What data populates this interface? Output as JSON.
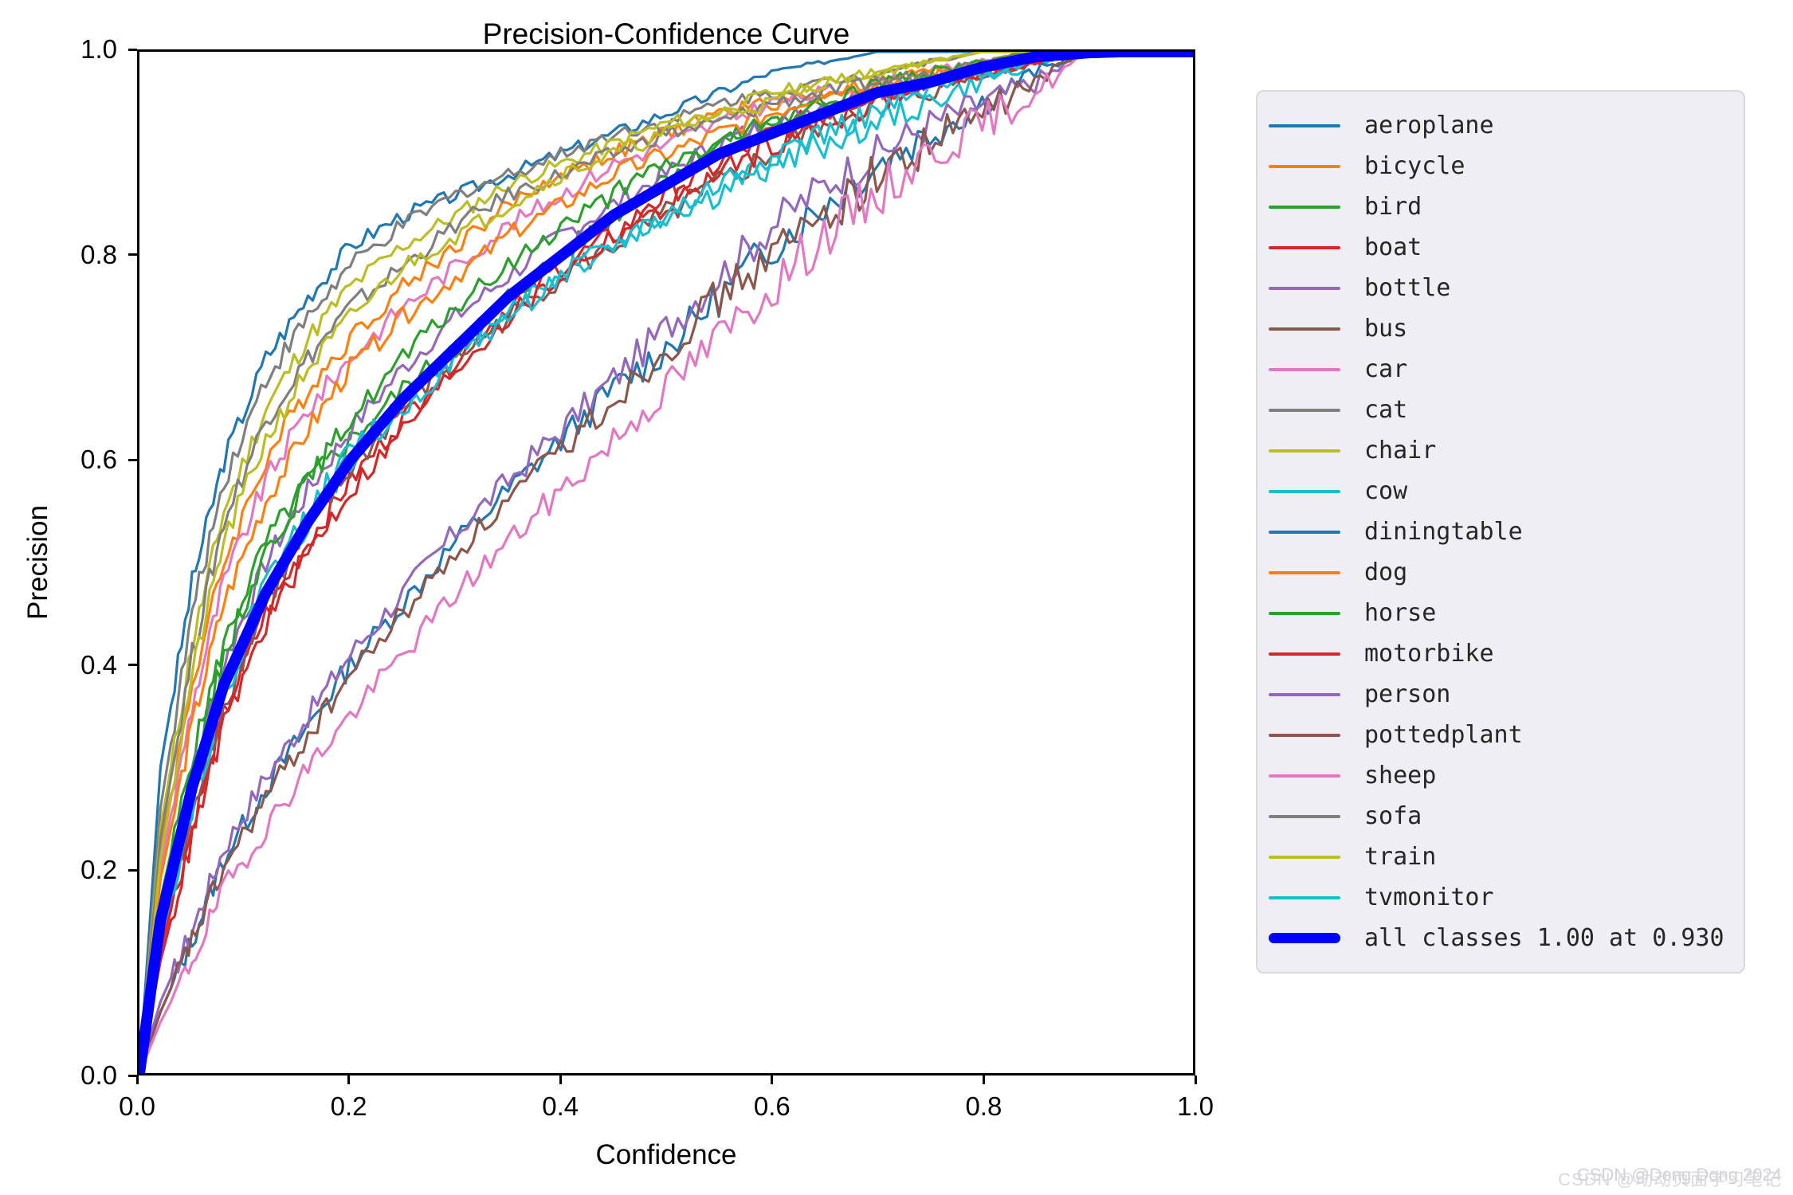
{
  "chart_data": {
    "type": "line",
    "title": "Precision-Confidence Curve",
    "xlabel": "Confidence",
    "ylabel": "Precision",
    "xlim": [
      0.0,
      1.0
    ],
    "ylim": [
      0.0,
      1.0
    ],
    "xticks": [
      "0.0",
      "0.2",
      "0.4",
      "0.6",
      "0.8",
      "1.0"
    ],
    "yticks": [
      "0.0",
      "0.2",
      "0.4",
      "0.6",
      "0.8",
      "1.0"
    ],
    "xtick_values": [
      0.0,
      0.2,
      0.4,
      0.6,
      0.8,
      1.0
    ],
    "ytick_values": [
      0.0,
      0.2,
      0.4,
      0.6,
      0.8,
      1.0
    ],
    "grid": false,
    "legend_position": "right outside",
    "summary_label": "all classes 1.00 at 0.930",
    "summary_precision": 1.0,
    "summary_confidence": 0.93,
    "x": [
      0.0,
      0.02,
      0.05,
      0.08,
      0.12,
      0.16,
      0.2,
      0.25,
      0.3,
      0.35,
      0.4,
      0.45,
      0.5,
      0.55,
      0.6,
      0.65,
      0.7,
      0.75,
      0.8,
      0.85,
      0.9,
      0.93,
      1.0
    ],
    "series": [
      {
        "name": "aeroplane",
        "color": "#1f77b4",
        "values": [
          0.0,
          0.3,
          0.48,
          0.6,
          0.7,
          0.76,
          0.81,
          0.84,
          0.86,
          0.88,
          0.9,
          0.92,
          0.94,
          0.96,
          0.98,
          0.99,
          1.0,
          1.0,
          1.0,
          1.0,
          1.0,
          1.0,
          1.0
        ]
      },
      {
        "name": "bicycle",
        "color": "#ff7f0e",
        "values": [
          0.0,
          0.22,
          0.38,
          0.5,
          0.6,
          0.67,
          0.72,
          0.77,
          0.81,
          0.85,
          0.88,
          0.9,
          0.92,
          0.94,
          0.95,
          0.96,
          0.97,
          0.98,
          0.99,
          1.0,
          1.0,
          1.0,
          1.0
        ]
      },
      {
        "name": "bird",
        "color": "#2ca02c",
        "values": [
          0.0,
          0.17,
          0.31,
          0.42,
          0.52,
          0.58,
          0.62,
          0.67,
          0.71,
          0.76,
          0.8,
          0.84,
          0.88,
          0.91,
          0.93,
          0.95,
          0.96,
          0.97,
          0.98,
          0.99,
          1.0,
          1.0,
          1.0
        ]
      },
      {
        "name": "boat",
        "color": "#d62728",
        "values": [
          0.0,
          0.12,
          0.24,
          0.35,
          0.45,
          0.52,
          0.58,
          0.64,
          0.7,
          0.75,
          0.79,
          0.82,
          0.86,
          0.89,
          0.92,
          0.94,
          0.96,
          0.97,
          0.98,
          0.99,
          1.0,
          1.0,
          1.0
        ]
      },
      {
        "name": "bottle",
        "color": "#9467bd",
        "values": [
          0.0,
          0.16,
          0.29,
          0.4,
          0.5,
          0.57,
          0.63,
          0.69,
          0.74,
          0.78,
          0.82,
          0.85,
          0.88,
          0.91,
          0.93,
          0.95,
          0.96,
          0.97,
          0.98,
          0.99,
          1.0,
          1.0,
          1.0
        ]
      },
      {
        "name": "bus",
        "color": "#8c564b",
        "values": [
          0.0,
          0.13,
          0.25,
          0.36,
          0.46,
          0.53,
          0.59,
          0.65,
          0.7,
          0.74,
          0.78,
          0.81,
          0.84,
          0.87,
          0.9,
          0.93,
          0.95,
          0.96,
          0.98,
          0.99,
          1.0,
          1.0,
          1.0
        ]
      },
      {
        "name": "car",
        "color": "#e377c2",
        "values": [
          0.0,
          0.2,
          0.36,
          0.48,
          0.58,
          0.65,
          0.7,
          0.75,
          0.79,
          0.83,
          0.86,
          0.89,
          0.91,
          0.93,
          0.95,
          0.96,
          0.97,
          0.98,
          0.99,
          1.0,
          1.0,
          1.0,
          1.0
        ]
      },
      {
        "name": "cat",
        "color": "#7f7f7f",
        "values": [
          0.0,
          0.26,
          0.45,
          0.58,
          0.68,
          0.74,
          0.79,
          0.83,
          0.86,
          0.88,
          0.9,
          0.92,
          0.93,
          0.95,
          0.96,
          0.97,
          0.98,
          0.99,
          1.0,
          1.0,
          1.0,
          1.0,
          1.0
        ]
      },
      {
        "name": "chair",
        "color": "#bcbd22",
        "values": [
          0.0,
          0.24,
          0.42,
          0.55,
          0.65,
          0.72,
          0.77,
          0.81,
          0.84,
          0.87,
          0.89,
          0.91,
          0.93,
          0.94,
          0.96,
          0.97,
          0.98,
          0.99,
          1.0,
          1.0,
          1.0,
          1.0,
          1.0
        ]
      },
      {
        "name": "cow",
        "color": "#17becf",
        "values": [
          0.0,
          0.14,
          0.27,
          0.38,
          0.48,
          0.55,
          0.61,
          0.66,
          0.71,
          0.75,
          0.78,
          0.81,
          0.84,
          0.86,
          0.89,
          0.91,
          0.93,
          0.95,
          0.97,
          0.99,
          1.0,
          1.0,
          1.0
        ]
      },
      {
        "name": "diningtable",
        "color": "#1f77b4",
        "values": [
          0.0,
          0.06,
          0.13,
          0.21,
          0.28,
          0.34,
          0.4,
          0.46,
          0.52,
          0.57,
          0.62,
          0.67,
          0.71,
          0.76,
          0.81,
          0.85,
          0.89,
          0.92,
          0.95,
          0.98,
          1.0,
          1.0,
          1.0
        ]
      },
      {
        "name": "dog",
        "color": "#ff7f0e",
        "values": [
          0.0,
          0.19,
          0.34,
          0.46,
          0.56,
          0.63,
          0.69,
          0.74,
          0.78,
          0.82,
          0.85,
          0.88,
          0.9,
          0.92,
          0.94,
          0.96,
          0.97,
          0.98,
          0.99,
          1.0,
          1.0,
          1.0,
          1.0
        ]
      },
      {
        "name": "horse",
        "color": "#2ca02c",
        "values": [
          0.0,
          0.15,
          0.29,
          0.41,
          0.51,
          0.58,
          0.64,
          0.7,
          0.75,
          0.79,
          0.83,
          0.86,
          0.89,
          0.91,
          0.93,
          0.95,
          0.97,
          0.98,
          0.99,
          1.0,
          1.0,
          1.0,
          1.0
        ]
      },
      {
        "name": "motorbike",
        "color": "#d62728",
        "values": [
          0.0,
          0.11,
          0.23,
          0.34,
          0.44,
          0.51,
          0.57,
          0.63,
          0.69,
          0.74,
          0.78,
          0.82,
          0.85,
          0.88,
          0.91,
          0.93,
          0.95,
          0.97,
          0.98,
          0.99,
          1.0,
          1.0,
          1.0
        ]
      },
      {
        "name": "person",
        "color": "#9467bd",
        "values": [
          0.0,
          0.07,
          0.14,
          0.22,
          0.29,
          0.35,
          0.41,
          0.47,
          0.53,
          0.58,
          0.63,
          0.68,
          0.73,
          0.78,
          0.83,
          0.87,
          0.9,
          0.93,
          0.95,
          0.97,
          1.0,
          1.0,
          1.0
        ]
      },
      {
        "name": "pottedplant",
        "color": "#8c564b",
        "values": [
          0.0,
          0.06,
          0.13,
          0.2,
          0.27,
          0.33,
          0.39,
          0.45,
          0.51,
          0.56,
          0.61,
          0.66,
          0.71,
          0.76,
          0.8,
          0.84,
          0.88,
          0.91,
          0.94,
          0.97,
          1.0,
          1.0,
          1.0
        ]
      },
      {
        "name": "sheep",
        "color": "#e377c2",
        "values": [
          0.0,
          0.05,
          0.11,
          0.18,
          0.24,
          0.3,
          0.35,
          0.41,
          0.47,
          0.52,
          0.57,
          0.62,
          0.67,
          0.72,
          0.77,
          0.82,
          0.86,
          0.9,
          0.93,
          0.96,
          1.0,
          1.0,
          1.0
        ]
      },
      {
        "name": "sofa",
        "color": "#7f7f7f",
        "values": [
          0.0,
          0.23,
          0.41,
          0.54,
          0.64,
          0.7,
          0.75,
          0.79,
          0.83,
          0.86,
          0.88,
          0.9,
          0.92,
          0.93,
          0.95,
          0.96,
          0.97,
          0.98,
          0.99,
          1.0,
          1.0,
          1.0,
          1.0
        ]
      },
      {
        "name": "train",
        "color": "#bcbd22",
        "values": [
          0.0,
          0.21,
          0.39,
          0.52,
          0.62,
          0.69,
          0.74,
          0.79,
          0.82,
          0.85,
          0.88,
          0.9,
          0.92,
          0.94,
          0.95,
          0.97,
          0.98,
          0.99,
          1.0,
          1.0,
          1.0,
          1.0,
          1.0
        ]
      },
      {
        "name": "tvmonitor",
        "color": "#17becf",
        "values": [
          0.0,
          0.13,
          0.26,
          0.37,
          0.47,
          0.54,
          0.6,
          0.65,
          0.7,
          0.74,
          0.78,
          0.81,
          0.84,
          0.87,
          0.9,
          0.92,
          0.94,
          0.96,
          0.98,
          0.99,
          1.0,
          1.0,
          1.0
        ]
      },
      {
        "name": "all classes 1.00 at 0.930",
        "color": "#0000ff",
        "emphasis": true,
        "values": [
          0.0,
          0.15,
          0.28,
          0.38,
          0.47,
          0.54,
          0.6,
          0.66,
          0.71,
          0.76,
          0.8,
          0.84,
          0.87,
          0.9,
          0.92,
          0.94,
          0.96,
          0.97,
          0.985,
          0.995,
          0.999,
          1.0,
          1.0
        ]
      }
    ]
  },
  "legend": {
    "entries": [
      {
        "label": "aeroplane",
        "color": "#1f77b4",
        "thick": false
      },
      {
        "label": "bicycle",
        "color": "#ff7f0e",
        "thick": false
      },
      {
        "label": "bird",
        "color": "#2ca02c",
        "thick": false
      },
      {
        "label": "boat",
        "color": "#d62728",
        "thick": false
      },
      {
        "label": "bottle",
        "color": "#9467bd",
        "thick": false
      },
      {
        "label": "bus",
        "color": "#8c564b",
        "thick": false
      },
      {
        "label": "car",
        "color": "#e377c2",
        "thick": false
      },
      {
        "label": "cat",
        "color": "#7f7f7f",
        "thick": false
      },
      {
        "label": "chair",
        "color": "#bcbd22",
        "thick": false
      },
      {
        "label": "cow",
        "color": "#17becf",
        "thick": false
      },
      {
        "label": "diningtable",
        "color": "#1f77b4",
        "thick": false
      },
      {
        "label": "dog",
        "color": "#ff7f0e",
        "thick": false
      },
      {
        "label": "horse",
        "color": "#2ca02c",
        "thick": false
      },
      {
        "label": "motorbike",
        "color": "#d62728",
        "thick": false
      },
      {
        "label": "person",
        "color": "#9467bd",
        "thick": false
      },
      {
        "label": "pottedplant",
        "color": "#8c564b",
        "thick": false
      },
      {
        "label": "sheep",
        "color": "#e377c2",
        "thick": false
      },
      {
        "label": "sofa",
        "color": "#7f7f7f",
        "thick": false
      },
      {
        "label": "train",
        "color": "#bcbd22",
        "thick": false
      },
      {
        "label": "tvmonitor",
        "color": "#17becf",
        "thick": false
      },
      {
        "label": "all classes 1.00 at 0.930",
        "color": "#0000ff",
        "thick": true
      }
    ]
  },
  "watermark": {
    "line1": "CSDN @Dong Dong 2024",
    "line2": "CSDN @动动页面学习笔记"
  }
}
